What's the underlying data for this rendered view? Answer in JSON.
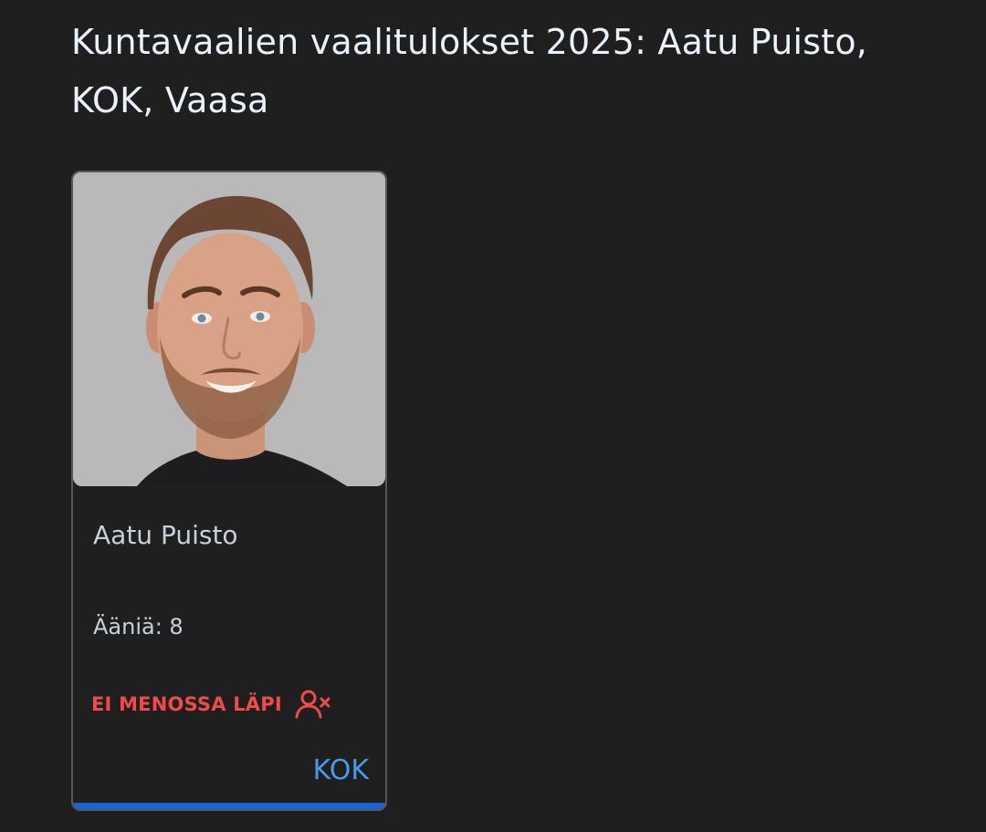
{
  "page": {
    "title": "Kuntavaalien vaalitulokset 2025: Aatu Puisto, KOK, Vaasa"
  },
  "candidate_card": {
    "photo_icon": "candidate-portrait",
    "name": "Aatu Puisto",
    "votes_text": "Ääniä: 8",
    "status_text": "EI MENOSSA LÄPI",
    "status_icon": "user-x-icon",
    "party": "KOK"
  },
  "colors": {
    "background": "#1f1f1f",
    "title": "#eaf2fb",
    "card_border": "#55585c",
    "body_text": "#c7d0da",
    "status_red": "#ef4b4b",
    "party_blue": "#4a9aec",
    "accent_bar": "#1765d6"
  }
}
